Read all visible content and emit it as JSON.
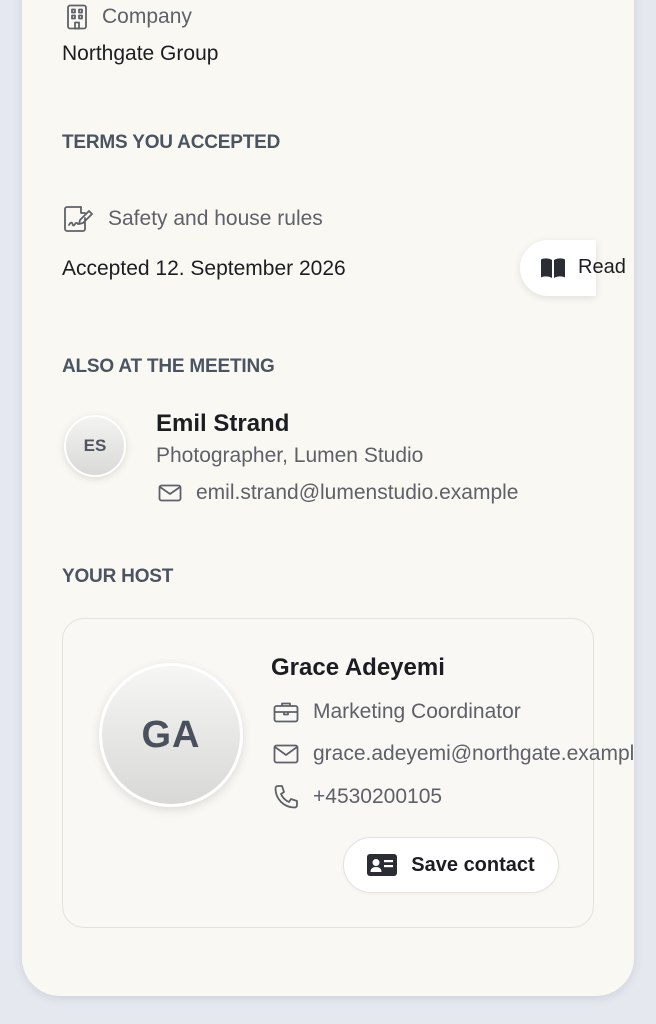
{
  "company": {
    "label": "Company",
    "value": "Northgate Group"
  },
  "terms": {
    "section_title": "TERMS YOU ACCEPTED",
    "doc_label": "Safety and house rules",
    "accepted_text": "Accepted 12. September 2026",
    "read_label": "Read"
  },
  "attendees": {
    "section_title": "ALSO AT THE MEETING",
    "items": [
      {
        "initials": "ES",
        "name": "Emil Strand",
        "role": "Photographer, Lumen Studio",
        "email": "emil.strand@lumenstudio.example"
      }
    ]
  },
  "host": {
    "section_title": "YOUR HOST",
    "initials": "GA",
    "name": "Grace Adeyemi",
    "title": "Marketing Coordinator",
    "email": "grace.adeyemi@northgate.example",
    "phone": "+4530200105",
    "save_label": "Save contact"
  },
  "icons": {
    "company": "building-icon",
    "terms": "signed-document-icon",
    "read": "book-icon",
    "email": "envelope-icon",
    "job": "briefcase-icon",
    "phone": "phone-icon",
    "save": "contact-card-icon"
  }
}
